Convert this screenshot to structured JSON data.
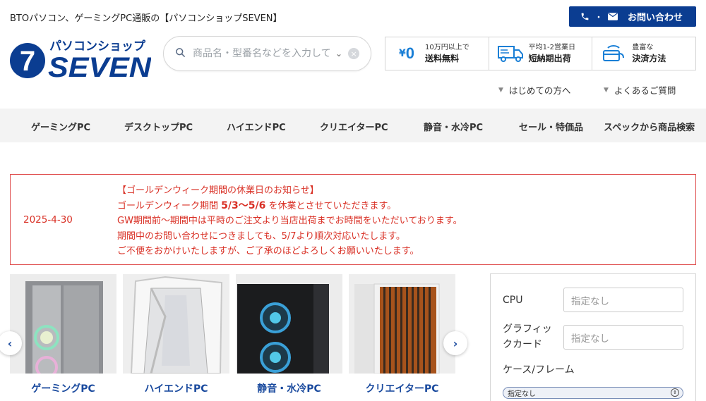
{
  "header": {
    "tagline": "BTOパソコン、ゲーミングPC通販の【パソコンショップSEVEN】",
    "contact_label": "お問い合わせ",
    "contact_dot": "・",
    "logo_top": "パソコンショップ",
    "logo_main": "SEVEN",
    "logo_num": "7"
  },
  "search": {
    "placeholder": "商品名・型番名などを入力して"
  },
  "features": [
    {
      "icon": "yen-zero-icon",
      "small": "10万円以上で",
      "big": "送料無料",
      "yen": "¥",
      "zero": "0"
    },
    {
      "icon": "truck-icon",
      "small": "平均1-2営業日",
      "big": "短納期出荷"
    },
    {
      "icon": "card-hand-icon",
      "small": "豊富な",
      "big": "決済方法"
    }
  ],
  "help": {
    "first_time": "はじめての方へ",
    "faq": "よくあるご質問"
  },
  "nav": [
    "ゲーミングPC",
    "デスクトップPC",
    "ハイエンドPC",
    "クリエイターPC",
    "静音・水冷PC",
    "セール・特価品",
    "スペックから商品検索"
  ],
  "notice": {
    "date": "2025-4-30",
    "line1": "【ゴールデンウィーク期間の休業日のお知らせ】",
    "line2_pre": "ゴールデンウィーク期間 ",
    "line2_bold": "5/3〜5/6",
    "line2_post": " を休業とさせていただきます。",
    "line3": "GW期間前〜期間中は平時のご注文より当店出荷までお時間をいただいております。",
    "line4": "期間中のお問い合わせにつきましても、5/7より順次対応いたします。",
    "line5": "ご不便をおかけいたしますが、ご了承のほどよろしくお願いいたします。"
  },
  "carousel": {
    "items": [
      {
        "label": "ゲーミングPC"
      },
      {
        "label": "ハイエンドPC"
      },
      {
        "label": "静音・水冷PC"
      },
      {
        "label": "クリエイターPC"
      }
    ],
    "prev": "‹",
    "next": "›"
  },
  "filter": {
    "cpu_label": "CPU",
    "cpu_value": "指定なし",
    "gpu_label_1": "グラフィッ",
    "gpu_label_2": "クカード",
    "gpu_value": "指定なし",
    "case_label": "ケース/フレーム",
    "case_value": "指定なし"
  },
  "colors": {
    "brand_blue": "#0b3d91",
    "notice_red": "#d93025",
    "link_blue": "#1a4a9e"
  }
}
